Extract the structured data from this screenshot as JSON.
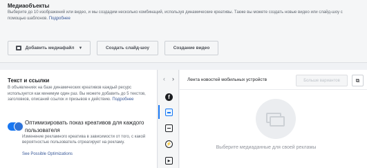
{
  "media": {
    "title": "Медиаобъекты",
    "description": "Выберите до 10 изображений или видео, и мы создадим несколько комбинаций, используя динамические креативы. Также вы можете создать новые видео или слайд-шоу с помощью шаблонов.",
    "more_link": "Подробнее",
    "add_media_label": "Добавить медиафайл",
    "create_slideshow_label": "Создать слайд-шоу",
    "create_video_label": "Создание видео"
  },
  "text_links": {
    "title": "Текст и ссылки",
    "description": "В объявлениях на базе динамических креативов каждый ресурс используется как минимум один раз. Вы можете добавить до 5 текстов, заголовков, описаний ссылок и призывов к действию.",
    "more_link": "Подробнее",
    "optimize_label": "Оптимизировать показ креативов для каждого пользователя",
    "optimize_desc": "Изменение рекламного креатива в зависимости от того, с какой вероятностью пользователь отреагирует на рекламу.",
    "optimizations_link": "See Possible Optimizations"
  },
  "preview": {
    "placement_title": "Лента новостей мобильных устройств",
    "more_variants_label": "Больше вариантов",
    "empty_hint": "Выберите медиаданные для своей рекламы"
  },
  "colors": {
    "accent": "#1877f2",
    "link": "#385898"
  }
}
